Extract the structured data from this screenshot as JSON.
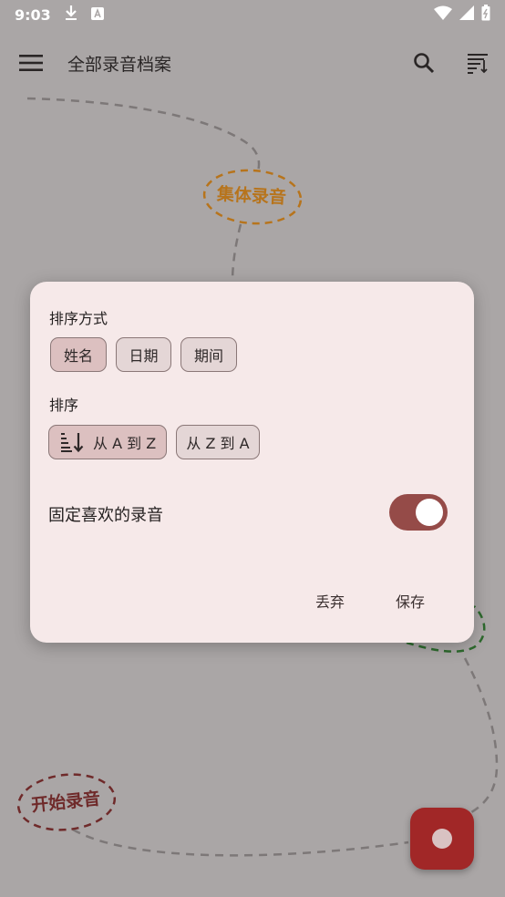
{
  "status_bar": {
    "time": "9:03",
    "icons": [
      "download-icon",
      "font-icon",
      "wifi-icon",
      "signal-icon",
      "battery-icon"
    ]
  },
  "app_bar": {
    "title": "全部录音档案",
    "icons": [
      "menu-icon",
      "search-icon",
      "sort-icon"
    ]
  },
  "background": {
    "bubble_top": "集体录音",
    "bubble_bottom": "开始录音",
    "colors": {
      "bubble_top": "#b7741c",
      "bubble_bottom": "#6f2a2a",
      "path_green": "#2e6a2e"
    }
  },
  "dialog": {
    "sort_by_label": "排序方式",
    "sort_by_options": [
      {
        "label": "姓名",
        "selected": true
      },
      {
        "label": "日期",
        "selected": false
      },
      {
        "label": "期间",
        "selected": false
      }
    ],
    "order_label": "排序",
    "order_options": [
      {
        "label": "从 A 到 Z",
        "selected": true,
        "icon": "sort-ascending-icon"
      },
      {
        "label": "从 Z 到 A",
        "selected": false
      }
    ],
    "pin_favorites_label": "固定喜欢的录音",
    "pin_favorites_on": true,
    "discard_label": "丢弃",
    "save_label": "保存"
  },
  "fab": {
    "icon": "record-icon",
    "color": "#a12727"
  },
  "colors": {
    "dialog_bg": "#f6e9e9",
    "accent": "#954b48",
    "scrim": "#aaa6a6"
  }
}
